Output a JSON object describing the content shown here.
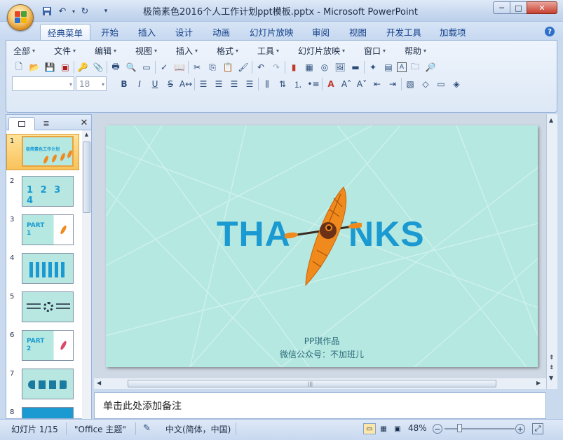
{
  "window": {
    "title": "极简素色2016个人工作计划ppt模板.pptx - Microsoft PowerPoint",
    "minimize": "─",
    "maximize": "□",
    "close": "✕"
  },
  "quick_access": [
    "save-icon",
    "undo-icon",
    "redo-icon"
  ],
  "ribbon_tabs": [
    "经典菜单",
    "开始",
    "插入",
    "设计",
    "动画",
    "幻灯片放映",
    "审阅",
    "视图",
    "开发工具",
    "加载项"
  ],
  "classic_menu": [
    "全部",
    "文件",
    "编辑",
    "视图",
    "插入",
    "格式",
    "工具",
    "幻灯片放映",
    "窗口",
    "帮助"
  ],
  "font_name": "",
  "font_size": "18",
  "panel_tabs": [
    "slides-tab",
    "outline-tab"
  ],
  "thumbnails": [
    {
      "num": "1",
      "label": "极简素色工作计划"
    },
    {
      "num": "2",
      "label": "1 2 3 4"
    },
    {
      "num": "3",
      "label": "PART 1"
    },
    {
      "num": "4",
      "label": ""
    },
    {
      "num": "5",
      "label": ""
    },
    {
      "num": "6",
      "label": "PART 2"
    },
    {
      "num": "7",
      "label": ""
    },
    {
      "num": "8",
      "label": ""
    }
  ],
  "slide": {
    "thanks_left": "THA",
    "thanks_right": "NKS",
    "credit": "PP琪作品",
    "wechat": "微信公众号：不加班儿",
    "colors": {
      "background": "#b6e8e2",
      "text": "#1a9ad0",
      "kayak": "#f08a1c"
    }
  },
  "notes_placeholder": "单击此处添加备注",
  "status": {
    "slide_indicator": "幻灯片 1/15",
    "theme": "\"Office 主题\"",
    "language": "中文(简体，中国)",
    "zoom": "48%"
  }
}
